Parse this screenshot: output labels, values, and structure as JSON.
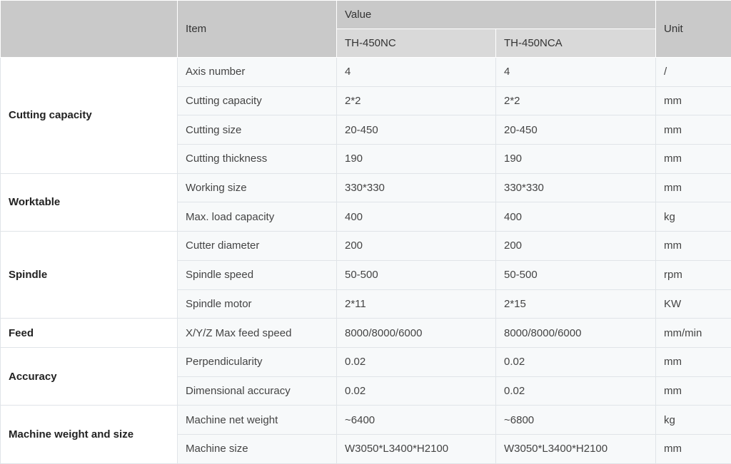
{
  "header": {
    "item": "Item",
    "value": "Value",
    "unit": "Unit",
    "model1": "TH-450NC",
    "model2": "TH-450NCA"
  },
  "groups": [
    {
      "name": "Cutting capacity",
      "rows": [
        {
          "item": "Axis number",
          "v1": "4",
          "v2": "4",
          "unit": "/"
        },
        {
          "item": "Cutting capacity",
          "v1": "2*2",
          "v2": "2*2",
          "unit": "mm"
        },
        {
          "item": "Cutting size",
          "v1": "20-450",
          "v2": "20-450",
          "unit": "mm"
        },
        {
          "item": "Cutting thickness",
          "v1": "190",
          "v2": "190",
          "unit": "mm"
        }
      ]
    },
    {
      "name": "Worktable",
      "rows": [
        {
          "item": "Working size",
          "v1": "330*330",
          "v2": "330*330",
          "unit": "mm"
        },
        {
          "item": "Max. load capacity",
          "v1": "400",
          "v2": "400",
          "unit": "kg"
        }
      ]
    },
    {
      "name": "Spindle",
      "rows": [
        {
          "item": "Cutter diameter",
          "v1": "200",
          "v2": "200",
          "unit": "mm"
        },
        {
          "item": "Spindle speed",
          "v1": "50-500",
          "v2": "50-500",
          "unit": "rpm"
        },
        {
          "item": "Spindle motor",
          "v1": "2*11",
          "v2": "2*15",
          "unit": "KW"
        }
      ]
    },
    {
      "name": "Feed",
      "rows": [
        {
          "item": "X/Y/Z Max feed speed",
          "v1": "8000/8000/6000",
          "v2": "8000/8000/6000",
          "unit": "mm/min"
        }
      ]
    },
    {
      "name": "Accuracy",
      "rows": [
        {
          "item": "Perpendicularity",
          "v1": "0.02",
          "v2": "0.02",
          "unit": "mm"
        },
        {
          "item": "Dimensional accuracy",
          "v1": "0.02",
          "v2": "0.02",
          "unit": "mm"
        }
      ]
    },
    {
      "name": "Machine weight and size",
      "rows": [
        {
          "item": "Machine net weight",
          "v1": "~6400",
          "v2": "~6800",
          "unit": "kg"
        },
        {
          "item": "Machine size",
          "v1": "W3050*L3400*H2100",
          "v2": "W3050*L3400*H2100",
          "unit": "mm"
        }
      ]
    }
  ]
}
